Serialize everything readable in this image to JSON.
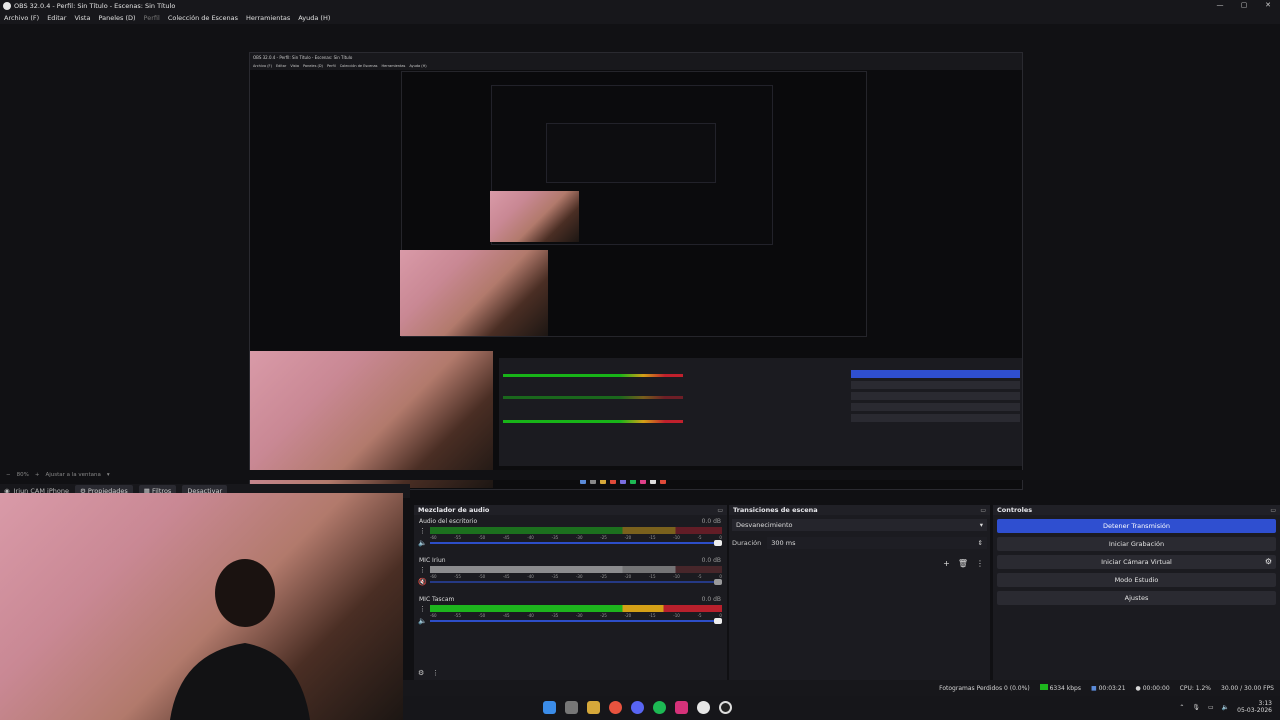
{
  "window": {
    "title": "OBS 32.0.4 - Perfil: Sin Título - Escenas: Sin Título",
    "controls": [
      "—",
      "▢",
      "✕"
    ]
  },
  "menu": {
    "items": [
      "Archivo (F)",
      "Editar",
      "Vista",
      "Paneles (D)",
      "Perfil",
      "Colección de Escenas",
      "Herramientas",
      "Ayuda (H)"
    ]
  },
  "nested": {
    "title": "OBS 32.0.4 - Perfil: Sin Título - Escenas: Sin Título",
    "menu": [
      "Archivo (F)",
      "Editar",
      "Vista",
      "Paneles (D)",
      "Perfil",
      "Colección de Escenas",
      "Herramientas",
      "Ayuda (H)"
    ]
  },
  "zoombar": {
    "zoom": "80%",
    "fit": "Ajustar a la ventana"
  },
  "source": {
    "name": "Iriun CAM iPhone",
    "properties": "Propiedades",
    "filters": "Filtros",
    "deactivate": "Desactivar"
  },
  "mixer": {
    "title": "Mezclador de audio",
    "channels": [
      {
        "name": "Audio del escritorio",
        "db": "0.0 dB",
        "level": 0.0
      },
      {
        "name": "MIC Iriun",
        "db": "0.0 dB",
        "level": 0.0
      },
      {
        "name": "MIC Tascam",
        "db": "0.0 dB",
        "level": 0.78
      }
    ],
    "ticks": [
      "-60",
      "-55",
      "-50",
      "-45",
      "-40",
      "-35",
      "-30",
      "-25",
      "-20",
      "-15",
      "-10",
      "-5",
      "0"
    ]
  },
  "transitions": {
    "title": "Transiciones de escena",
    "selected": "Desvanecimiento",
    "duration_label": "Duración",
    "duration_value": "300 ms"
  },
  "controls": {
    "title": "Controles",
    "stop_stream": "Detener Transmisión",
    "start_recording": "Iniciar Grabación",
    "start_virtual_cam": "Iniciar Cámara Virtual",
    "studio_mode": "Modo Estudio",
    "settings": "Ajustes"
  },
  "status": {
    "dropped": "Fotogramas Perdidos 0 (0.0%)",
    "bitrate": "6334 kbps",
    "stream_time": "00:03:21",
    "rec_time": "00:00:00",
    "cpu": "CPU: 1.2%",
    "fps": "30.00 / 30.00 FPS"
  },
  "tray": {
    "time": "3:13",
    "date": "05-03-2026"
  },
  "colors": {
    "accent": "#2f4fd0",
    "meter_green": "#1db51d",
    "meter_yellow": "#c89a1a",
    "meter_red": "#9c1e2a"
  }
}
